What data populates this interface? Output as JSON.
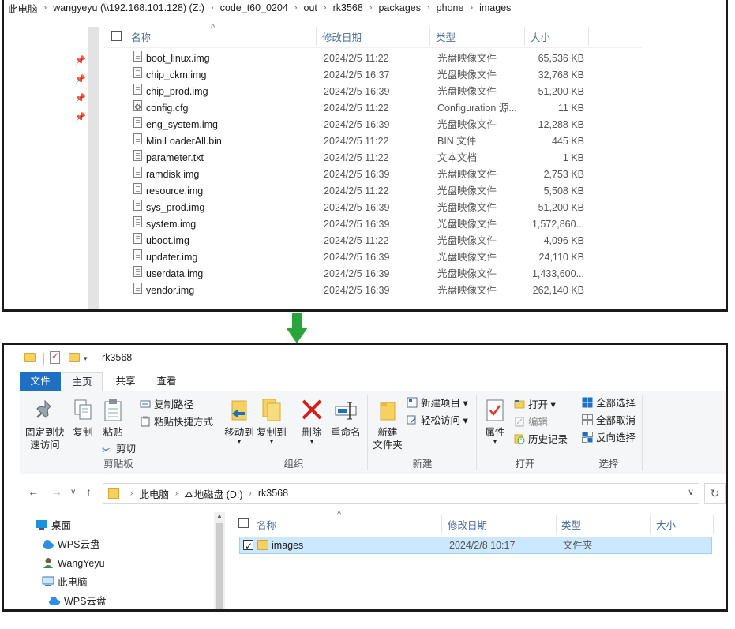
{
  "top_window": {
    "breadcrumb": [
      "此电脑",
      "wangyeyu (\\\\192.168.101.128) (Z:)",
      "code_t60_0204",
      "out",
      "rk3568",
      "packages",
      "phone",
      "images"
    ],
    "columns": {
      "name": "名称",
      "date": "修改日期",
      "type": "类型",
      "size": "大小"
    },
    "files": [
      {
        "name": "boot_linux.img",
        "date": "2024/2/5 11:22",
        "type": "光盘映像文件",
        "size": "65,536 KB"
      },
      {
        "name": "chip_ckm.img",
        "date": "2024/2/5 16:37",
        "type": "光盘映像文件",
        "size": "32,768 KB"
      },
      {
        "name": "chip_prod.img",
        "date": "2024/2/5 16:39",
        "type": "光盘映像文件",
        "size": "51,200 KB"
      },
      {
        "name": "config.cfg",
        "date": "2024/2/5 11:22",
        "type": "Configuration 源...",
        "size": "11 KB"
      },
      {
        "name": "eng_system.img",
        "date": "2024/2/5 16:39",
        "type": "光盘映像文件",
        "size": "12,288 KB"
      },
      {
        "name": "MiniLoaderAll.bin",
        "date": "2024/2/5 11:22",
        "type": "BIN 文件",
        "size": "445 KB"
      },
      {
        "name": "parameter.txt",
        "date": "2024/2/5 11:22",
        "type": "文本文档",
        "size": "1 KB"
      },
      {
        "name": "ramdisk.img",
        "date": "2024/2/5 16:39",
        "type": "光盘映像文件",
        "size": "2,753 KB"
      },
      {
        "name": "resource.img",
        "date": "2024/2/5 11:22",
        "type": "光盘映像文件",
        "size": "5,508 KB"
      },
      {
        "name": "sys_prod.img",
        "date": "2024/2/5 16:39",
        "type": "光盘映像文件",
        "size": "51,200 KB"
      },
      {
        "name": "system.img",
        "date": "2024/2/5 16:39",
        "type": "光盘映像文件",
        "size": "1,572,860..."
      },
      {
        "name": "uboot.img",
        "date": "2024/2/5 11:22",
        "type": "光盘映像文件",
        "size": "4,096 KB"
      },
      {
        "name": "updater.img",
        "date": "2024/2/5 16:39",
        "type": "光盘映像文件",
        "size": "24,110 KB"
      },
      {
        "name": "userdata.img",
        "date": "2024/2/5 16:39",
        "type": "光盘映像文件",
        "size": "1,433,600..."
      },
      {
        "name": "vendor.img",
        "date": "2024/2/5 16:39",
        "type": "光盘映像文件",
        "size": "262,140 KB"
      }
    ]
  },
  "bottom_window": {
    "title": "rk3568",
    "tabs": {
      "file": "文件",
      "home": "主页",
      "share": "共享",
      "view": "查看"
    },
    "ribbon": {
      "clipboard": {
        "label": "剪贴板",
        "pin_line1": "固定到快",
        "pin_line2": "速访问",
        "copy": "复制",
        "paste": "粘贴",
        "copy_path": "复制路径",
        "paste_shortcut": "粘贴快捷方式",
        "cut": "剪切"
      },
      "organize": {
        "label": "组织",
        "move_to": "移动到",
        "copy_to": "复制到",
        "delete": "删除",
        "rename": "重命名"
      },
      "new": {
        "label": "新建",
        "new_folder_line1": "新建",
        "new_folder_line2": "文件夹",
        "new_item": "新建项目",
        "easy_access": "轻松访问"
      },
      "open": {
        "label": "打开",
        "properties": "属性",
        "open": "打开",
        "edit": "编辑",
        "history": "历史记录"
      },
      "select": {
        "label": "选择",
        "select_all": "全部选择",
        "select_none": "全部取消",
        "invert": "反向选择"
      }
    },
    "address": [
      "此电脑",
      "本地磁盘 (D:)",
      "rk3568"
    ],
    "nav": [
      {
        "label": "桌面",
        "icon": "desktop-icon"
      },
      {
        "label": "WPS云盘",
        "icon": "cloud-icon"
      },
      {
        "label": "WangYeyu",
        "icon": "user-icon"
      },
      {
        "label": "此电脑",
        "icon": "computer-icon"
      },
      {
        "label": "WPS云盘",
        "icon": "cloud-icon"
      }
    ],
    "columns": {
      "name": "名称",
      "date": "修改日期",
      "type": "类型",
      "size": "大小"
    },
    "files": [
      {
        "name": "images",
        "date": "2024/2/8 10:17",
        "type": "文件夹",
        "size": ""
      }
    ]
  },
  "colors": {
    "accent": "#1f6fc2",
    "selection": "#cce8ff",
    "arrow": "#2aa53b",
    "header_text": "#4a6e9a",
    "folder": "#f5d161"
  }
}
